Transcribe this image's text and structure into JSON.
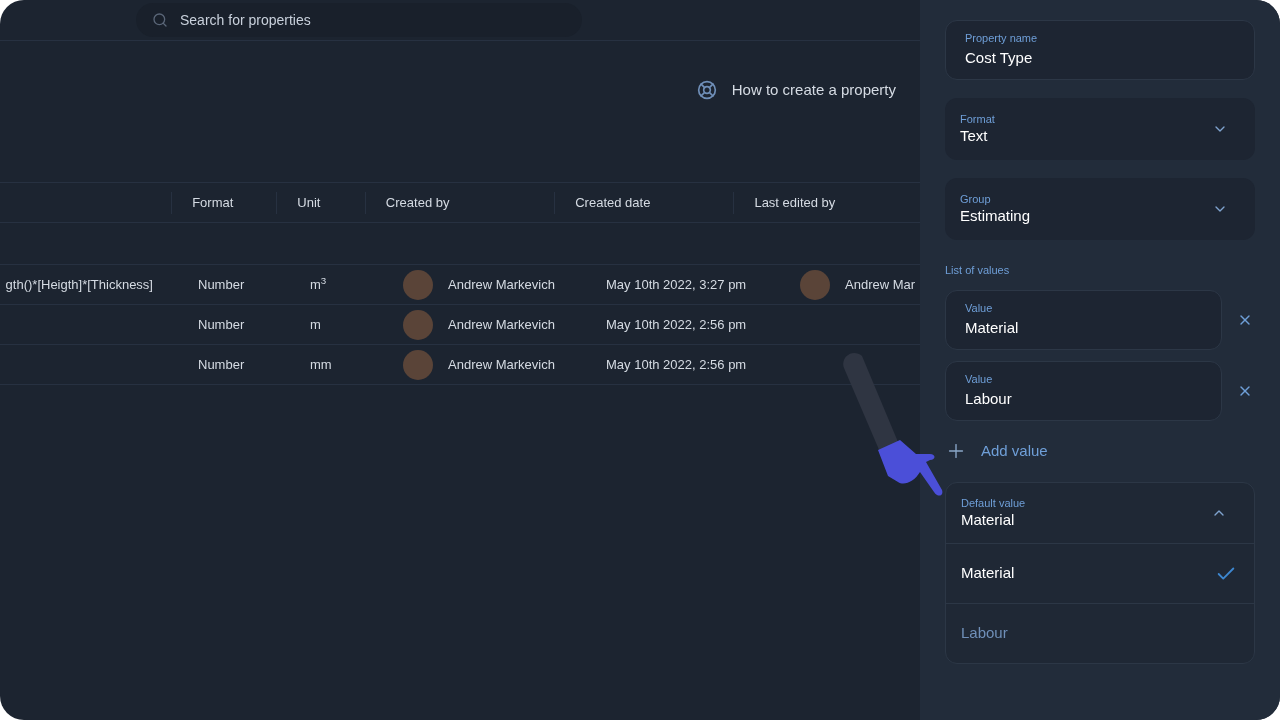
{
  "search": {
    "placeholder": "Search for properties"
  },
  "help_link": {
    "label": "How to create a property"
  },
  "table": {
    "columns": [
      "Format",
      "Unit",
      "Created by",
      "Created date",
      "Last edited by"
    ],
    "rows": [
      {
        "column_1": "gth()*[Heigth]*[Thickness]",
        "format": "Number",
        "unit": "m$^{3}$",
        "created_by": "Andrew Markevich",
        "created_date": "May 10th 2022, 3:27 pm",
        "last_edited_by": "Andrew Mar"
      },
      {
        "format": "Number",
        "unit": "m",
        "created_by": "Andrew Markevich",
        "created_date": "May 10th 2022, 2:56 pm"
      },
      {
        "format": "Number",
        "unit": "mm",
        "created_by": "Andrew Markevich",
        "created_date": "May 10th 2022, 2:56 pm"
      }
    ]
  },
  "panel": {
    "property_name": {
      "label": "Property name",
      "value": "Cost Type"
    },
    "format": {
      "label": "Format",
      "value": "Text"
    },
    "group": {
      "label": "Group",
      "value": "Estimating"
    },
    "list_of_values": {
      "title": "List of values",
      "values": [
        {
          "label": "Value",
          "value": "Material"
        },
        {
          "label": "Value",
          "value": "Labour"
        }
      ],
      "add_button": "Add value"
    },
    "default_value": {
      "label": "Default value",
      "value": "Material",
      "expanded": true,
      "options": [
        {
          "label": "Material",
          "selected": true
        },
        {
          "label": "Labour",
          "selected": false
        }
      ]
    }
  }
}
